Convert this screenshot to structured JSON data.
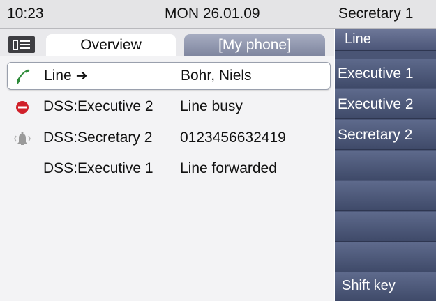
{
  "status_bar": {
    "time": "10:23",
    "date": "MON 26.01.09",
    "identity": "Secretary 1"
  },
  "tabs": [
    {
      "label": "Overview",
      "active": true
    },
    {
      "label": "[My phone]",
      "active": false
    }
  ],
  "menu_icon": "menu-icon",
  "lines": [
    {
      "name": "Line",
      "arrow": "➔",
      "status": "Bohr, Niels",
      "icon": "phone-handset-icon",
      "icon_color": "#2e8b3a",
      "selected": true
    },
    {
      "name": "DSS:Executive 2",
      "status": "Line busy",
      "icon": "busy-icon",
      "icon_color": "#d0202a"
    },
    {
      "name": "DSS:Secretary 2",
      "status": "0123456632419",
      "icon": "ringing-bell-icon",
      "icon_color": "#8c8c8c"
    },
    {
      "name": "DSS:Executive 1",
      "status": "Line forwarded",
      "icon": "",
      "icon_color": ""
    }
  ],
  "softkeys": {
    "header": "Line",
    "items": [
      "Executive 1",
      "Executive 2",
      "Secretary 2",
      "",
      "",
      "",
      ""
    ],
    "shift": "Shift key"
  },
  "colors": {
    "softkey_bg": "#4a5575",
    "tab_inactive": "#8b91a9",
    "status_bar": "#e4e4e6"
  }
}
